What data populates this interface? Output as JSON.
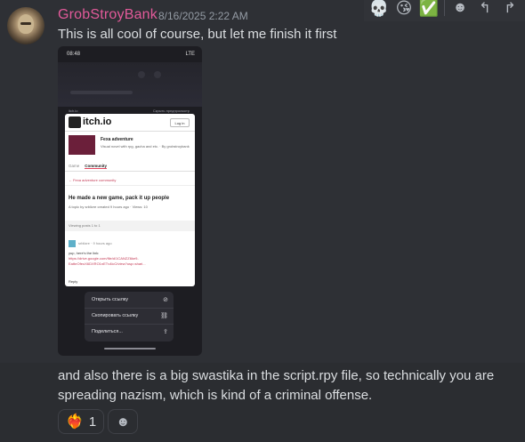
{
  "message": {
    "username": "GrobStroyBank",
    "timestamp": "8/16/2025 2:22 AM",
    "text": "This is all cool of course, but let me finish it first",
    "followup": "and also there is a big swastika in the script.rpy file, so technically you are spreading nazism, which is kind of a criminal offense."
  },
  "toolbar": {
    "items": [
      {
        "icon": "skull-emoji",
        "glyph": "💀"
      },
      {
        "icon": "kiss-emoji",
        "glyph": "😘"
      },
      {
        "icon": "check-emoji",
        "glyph": "✅"
      },
      {
        "icon": "add-reaction-icon",
        "glyph": "☻"
      },
      {
        "icon": "reply-icon",
        "glyph": "↰"
      },
      {
        "icon": "forward-icon",
        "glyph": "↱"
      }
    ]
  },
  "attachment": {
    "status_time": "08:48",
    "status_right": "LTE",
    "url_left": "itch.io",
    "url_right": "Скрыть предпросмотр",
    "site": "itch.io",
    "login": "Log in",
    "game_title": "Fexa adventure",
    "game_desc": "Visual novel with rpg, gacha and etc. · By grobstroybank",
    "tab_game": "Game",
    "tab_community": "Community",
    "crumb": "← Fexa adventure community",
    "topic_title": "He made a new game, pack it up people",
    "topic_meta": "A topic by srblizre created 9 hours ago · Views: 10",
    "viewing": "Viewing posts 1 to 1",
    "post_user": "srblizre · 9 hours ago",
    "post_text": "yup, here's the link:",
    "post_link": "https://drive.google.com/file/d/1CANZZ6ke9-EatbrOfeoX6DXRO1nETv4lcO/view?usp=shari...",
    "reply": "Reply",
    "menu": [
      {
        "label": "Открыть ссылку",
        "icon": "compass-icon",
        "glyph": "⊘"
      },
      {
        "label": "Скопировать ссылку",
        "icon": "link-icon",
        "glyph": "⛓"
      },
      {
        "label": "Поделиться...",
        "icon": "share-icon",
        "glyph": "⇪"
      }
    ]
  },
  "reactions": [
    {
      "emoji": "heart-on-fire",
      "glyph": "❤‍🔥",
      "count": "1"
    }
  ],
  "colors": {
    "username": "#e35a9a",
    "background": "#313338",
    "text": "#dbdee1"
  }
}
